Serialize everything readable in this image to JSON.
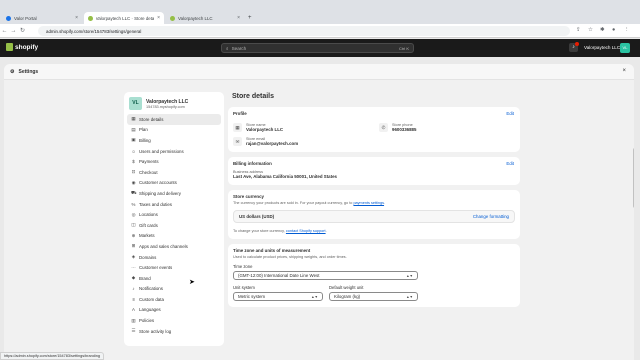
{
  "browser": {
    "tabs": [
      {
        "label": "Valor Portal",
        "color": "#1a73e8"
      },
      {
        "label": "Valorpaytech LLC · Store details",
        "color": "#95bf47"
      },
      {
        "label": "Valorpaytech LLC",
        "color": "#95bf47"
      }
    ],
    "new_tab": "+",
    "url": "admin.shopify.com/store/154783/settings/general"
  },
  "shopify": {
    "logo": "shopify",
    "search_placeholder": "Search",
    "search_shortcut": "Ctrl K",
    "store_name": "Valorpaytech LLC",
    "avatar": "VL"
  },
  "settings": {
    "title": "Settings",
    "close": "×"
  },
  "sidebar": {
    "avatar": "VL",
    "store_name": "Valorpaytech LLC",
    "store_url": "154783.myshopify.com",
    "items": [
      {
        "label": "Store details",
        "icon": "store-icon"
      },
      {
        "label": "Plan",
        "icon": "plan-icon"
      },
      {
        "label": "Billing",
        "icon": "billing-icon"
      },
      {
        "label": "Users and permissions",
        "icon": "users-icon"
      },
      {
        "label": "Payments",
        "icon": "payments-icon"
      },
      {
        "label": "Checkout",
        "icon": "checkout-icon"
      },
      {
        "label": "Customer accounts",
        "icon": "customer-icon"
      },
      {
        "label": "Shipping and delivery",
        "icon": "truck-icon"
      },
      {
        "label": "Taxes and duties",
        "icon": "tax-icon"
      },
      {
        "label": "Locations",
        "icon": "location-icon"
      },
      {
        "label": "Gift cards",
        "icon": "gift-icon"
      },
      {
        "label": "Markets",
        "icon": "globe-icon"
      },
      {
        "label": "Apps and sales channels",
        "icon": "apps-icon"
      },
      {
        "label": "Domains",
        "icon": "domain-icon"
      },
      {
        "label": "Customer events",
        "icon": "events-icon"
      },
      {
        "label": "Brand",
        "icon": "brand-icon"
      },
      {
        "label": "Notifications",
        "icon": "bell-icon"
      },
      {
        "label": "Custom data",
        "icon": "data-icon"
      },
      {
        "label": "Languages",
        "icon": "language-icon"
      },
      {
        "label": "Policies",
        "icon": "policy-icon"
      },
      {
        "label": "Store activity log",
        "icon": "log-icon"
      }
    ]
  },
  "main": {
    "title": "Store details",
    "profile": {
      "title": "Profile",
      "edit": "Edit",
      "store_name_label": "Store name",
      "store_name": "Valorpaytech LLC",
      "store_phone_label": "Store phone",
      "store_phone": "9600336885",
      "store_email_label": "Store email",
      "store_email": "rajan@valorpaytech.com"
    },
    "billing": {
      "title": "Billing information",
      "edit": "Edit",
      "address_label": "Business address",
      "address": "Last Ave, Alabama California 50001, United States"
    },
    "currency": {
      "title": "Store currency",
      "desc": "The currency your products are sold in. For your payout currency, go to ",
      "desc_link": "payments settings",
      "desc_end": ".",
      "value": "US dollars (USD)",
      "change": "Change formatting",
      "note": "To change your store currency, ",
      "note_link": "contact Shopify support",
      "note_end": "."
    },
    "time": {
      "title": "Time zone and units of measurement",
      "desc": "Used to calculate product prices, shipping weights, and order times.",
      "tz_label": "Time zone",
      "tz_value": "(GMT-12:00) International Date Line West",
      "unit_label": "Unit system",
      "unit_value": "Metric system",
      "weight_label": "Default weight unit",
      "weight_value": "Kilogram (kg)"
    }
  },
  "status_url": "https://admin.shopify.com/store/154783/settings/branding"
}
